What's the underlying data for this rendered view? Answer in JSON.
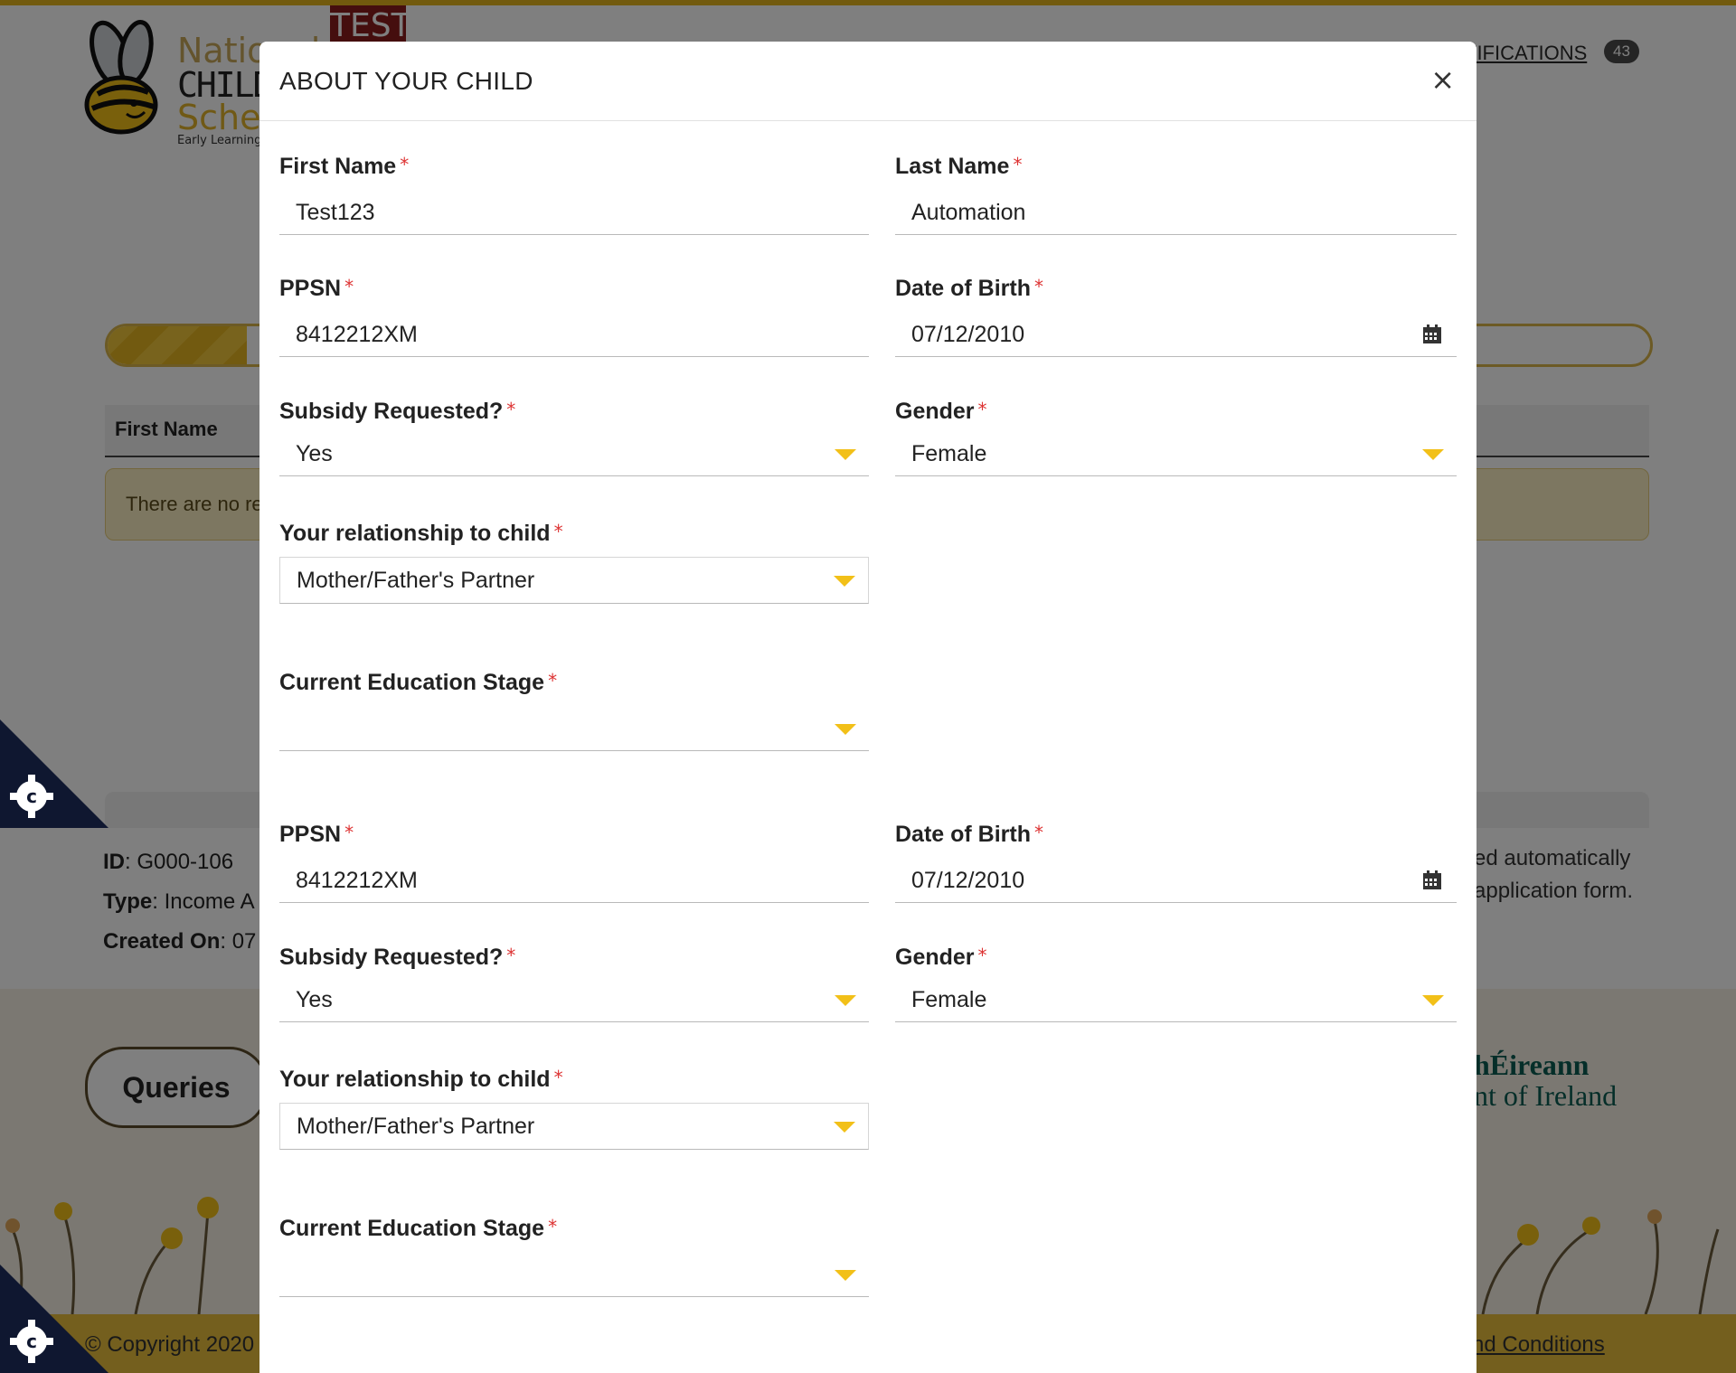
{
  "background": {
    "logo": {
      "line1": "National",
      "line2": "CHILDC",
      "line3": "Schem",
      "tagline": "Early Learning &"
    },
    "test_badge": "TEST",
    "notifications": {
      "label": "TIFICATIONS",
      "count": "43"
    },
    "progress": {
      "percent": 9
    },
    "table": {
      "first_col_header": "First Name"
    },
    "notice": "There are no re",
    "info": {
      "id_label": "ID",
      "id_value": ": G000-106",
      "type_label": "Type",
      "type_value": ": Income A",
      "created_label": "Created On",
      "created_value": ": 07"
    },
    "right_text": {
      "line1": "ed automatically",
      "line2": "application form."
    },
    "queries_button": "Queries",
    "gov": {
      "line1": "hÉireann",
      "line2": "nt of Ireland"
    },
    "copyright": "© Copyright 2020",
    "terms_link": "nd Conditions",
    "colors": {
      "brand_yellow": "#e8be3d",
      "accent_caret": "#f2c018",
      "required": "#dd3333",
      "badge": "#8b1c1c"
    }
  },
  "modal": {
    "title": "ABOUT YOUR CHILD",
    "close_icon": "×",
    "required_marker": "*",
    "section1": {
      "first_name": {
        "label": "First Name",
        "value": "Test123"
      },
      "last_name": {
        "label": "Last Name",
        "value": "Automation"
      },
      "ppsn": {
        "label": "PPSN",
        "value": "8412212XM"
      },
      "dob": {
        "label": "Date of Birth",
        "value": "07/12/2010"
      },
      "subsidy": {
        "label": "Subsidy Requested?",
        "value": "Yes"
      },
      "gender": {
        "label": "Gender",
        "value": "Female"
      },
      "relationship": {
        "label": "Your relationship to child",
        "value": "Mother/Father's Partner"
      },
      "education": {
        "label": "Current Education Stage",
        "value": ""
      }
    },
    "section2": {
      "ppsn": {
        "label": "PPSN",
        "value": "8412212XM"
      },
      "dob": {
        "label": "Date of Birth",
        "value": "07/12/2010"
      },
      "subsidy": {
        "label": "Subsidy Requested?",
        "value": "Yes"
      },
      "gender": {
        "label": "Gender",
        "value": "Female"
      },
      "relationship": {
        "label": "Your relationship to child",
        "value": "Mother/Father's Partner"
      },
      "education": {
        "label": "Current Education Stage",
        "value": ""
      }
    }
  }
}
